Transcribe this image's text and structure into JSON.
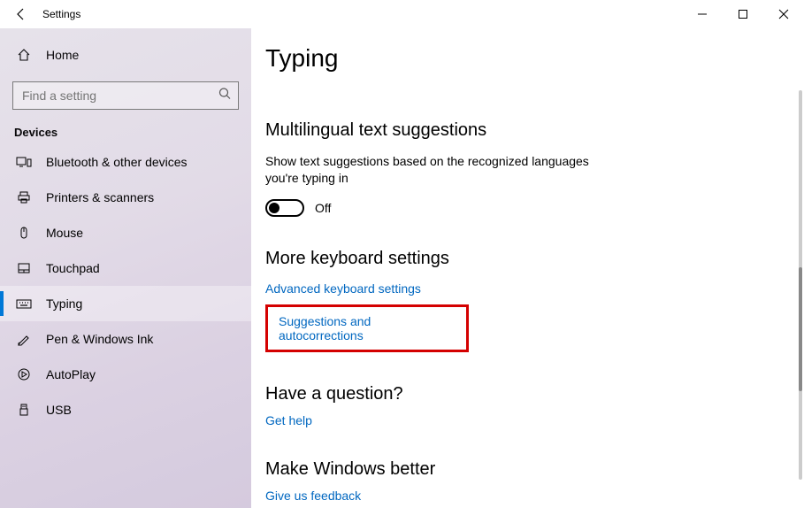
{
  "window": {
    "title": "Settings"
  },
  "sidebar": {
    "home_label": "Home",
    "search_placeholder": "Find a setting",
    "category": "Devices",
    "items": [
      {
        "label": "Bluetooth & other devices"
      },
      {
        "label": "Printers & scanners"
      },
      {
        "label": "Mouse"
      },
      {
        "label": "Touchpad"
      },
      {
        "label": "Typing"
      },
      {
        "label": "Pen & Windows Ink"
      },
      {
        "label": "AutoPlay"
      },
      {
        "label": "USB"
      }
    ]
  },
  "page": {
    "title": "Typing",
    "multilingual_heading": "Multilingual text suggestions",
    "multilingual_desc": "Show text suggestions based on the recognized languages you're typing in",
    "multilingual_toggle": "Off",
    "more_heading": "More keyboard settings",
    "link_advanced": "Advanced keyboard settings",
    "link_suggestions": "Suggestions and autocorrections",
    "question_heading": "Have a question?",
    "link_help": "Get help",
    "better_heading": "Make Windows better",
    "link_feedback": "Give us feedback"
  }
}
